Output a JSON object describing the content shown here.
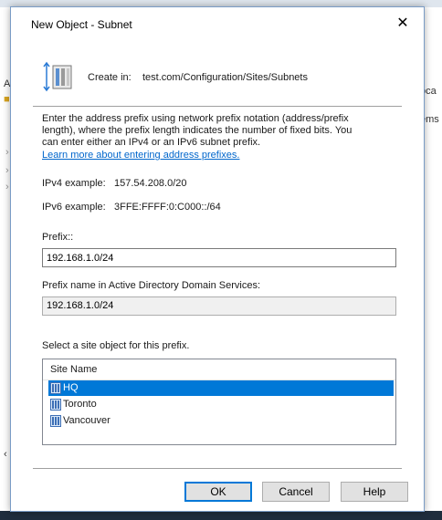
{
  "background": {
    "left_glyphs": [
      "A",
      "⌘",
      "›",
      "›",
      "›",
      "‹"
    ],
    "right_glyphs": [
      "oca",
      "ems"
    ]
  },
  "dialog": {
    "title": "New Object - Subnet",
    "close_glyph": "✕",
    "create_in_label": "Create in:",
    "create_in_path": "test.com/Configuration/Sites/Subnets",
    "description": "Enter the address prefix using network prefix notation (address/prefix length), where the prefix length indicates the number of fixed bits. You can enter either an IPv4 or an IPv6 subnet prefix.",
    "learn_more_link": "Learn more about entering address prefixes.",
    "ipv4_example_label": "IPv4 example:",
    "ipv4_example_value": "157.54.208.0/20",
    "ipv6_example_label": "IPv6 example:",
    "ipv6_example_value": "3FFE:FFFF:0:C000::/64",
    "prefix_label": "Prefix::",
    "prefix_value": "192.168.1.0/24",
    "prefix_name_label": "Prefix name in Active Directory Domain Services:",
    "prefix_name_value": "192.168.1.0/24",
    "site_select_label": "Select a site object for this prefix.",
    "site_list": {
      "column_header": "Site Name",
      "items": [
        {
          "name": "HQ",
          "selected": true
        },
        {
          "name": "Toronto",
          "selected": false
        },
        {
          "name": "Vancouver",
          "selected": false
        }
      ]
    },
    "buttons": {
      "ok": "OK",
      "cancel": "Cancel",
      "help": "Help"
    }
  },
  "colors": {
    "selection": "#0078d7",
    "link": "#0066cc"
  },
  "icons": [
    "subnet-object-icon",
    "site-icon",
    "close-icon"
  ]
}
